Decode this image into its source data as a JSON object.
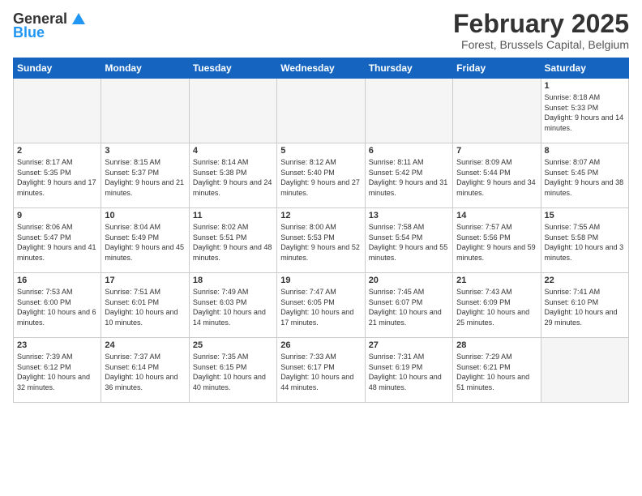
{
  "logo": {
    "general": "General",
    "blue": "Blue"
  },
  "title": "February 2025",
  "location": "Forest, Brussels Capital, Belgium",
  "days_of_week": [
    "Sunday",
    "Monday",
    "Tuesday",
    "Wednesday",
    "Thursday",
    "Friday",
    "Saturday"
  ],
  "weeks": [
    [
      {
        "day": "",
        "info": ""
      },
      {
        "day": "",
        "info": ""
      },
      {
        "day": "",
        "info": ""
      },
      {
        "day": "",
        "info": ""
      },
      {
        "day": "",
        "info": ""
      },
      {
        "day": "",
        "info": ""
      },
      {
        "day": "1",
        "info": "Sunrise: 8:18 AM\nSunset: 5:33 PM\nDaylight: 9 hours and 14 minutes."
      }
    ],
    [
      {
        "day": "2",
        "info": "Sunrise: 8:17 AM\nSunset: 5:35 PM\nDaylight: 9 hours and 17 minutes."
      },
      {
        "day": "3",
        "info": "Sunrise: 8:15 AM\nSunset: 5:37 PM\nDaylight: 9 hours and 21 minutes."
      },
      {
        "day": "4",
        "info": "Sunrise: 8:14 AM\nSunset: 5:38 PM\nDaylight: 9 hours and 24 minutes."
      },
      {
        "day": "5",
        "info": "Sunrise: 8:12 AM\nSunset: 5:40 PM\nDaylight: 9 hours and 27 minutes."
      },
      {
        "day": "6",
        "info": "Sunrise: 8:11 AM\nSunset: 5:42 PM\nDaylight: 9 hours and 31 minutes."
      },
      {
        "day": "7",
        "info": "Sunrise: 8:09 AM\nSunset: 5:44 PM\nDaylight: 9 hours and 34 minutes."
      },
      {
        "day": "8",
        "info": "Sunrise: 8:07 AM\nSunset: 5:45 PM\nDaylight: 9 hours and 38 minutes."
      }
    ],
    [
      {
        "day": "9",
        "info": "Sunrise: 8:06 AM\nSunset: 5:47 PM\nDaylight: 9 hours and 41 minutes."
      },
      {
        "day": "10",
        "info": "Sunrise: 8:04 AM\nSunset: 5:49 PM\nDaylight: 9 hours and 45 minutes."
      },
      {
        "day": "11",
        "info": "Sunrise: 8:02 AM\nSunset: 5:51 PM\nDaylight: 9 hours and 48 minutes."
      },
      {
        "day": "12",
        "info": "Sunrise: 8:00 AM\nSunset: 5:53 PM\nDaylight: 9 hours and 52 minutes."
      },
      {
        "day": "13",
        "info": "Sunrise: 7:58 AM\nSunset: 5:54 PM\nDaylight: 9 hours and 55 minutes."
      },
      {
        "day": "14",
        "info": "Sunrise: 7:57 AM\nSunset: 5:56 PM\nDaylight: 9 hours and 59 minutes."
      },
      {
        "day": "15",
        "info": "Sunrise: 7:55 AM\nSunset: 5:58 PM\nDaylight: 10 hours and 3 minutes."
      }
    ],
    [
      {
        "day": "16",
        "info": "Sunrise: 7:53 AM\nSunset: 6:00 PM\nDaylight: 10 hours and 6 minutes."
      },
      {
        "day": "17",
        "info": "Sunrise: 7:51 AM\nSunset: 6:01 PM\nDaylight: 10 hours and 10 minutes."
      },
      {
        "day": "18",
        "info": "Sunrise: 7:49 AM\nSunset: 6:03 PM\nDaylight: 10 hours and 14 minutes."
      },
      {
        "day": "19",
        "info": "Sunrise: 7:47 AM\nSunset: 6:05 PM\nDaylight: 10 hours and 17 minutes."
      },
      {
        "day": "20",
        "info": "Sunrise: 7:45 AM\nSunset: 6:07 PM\nDaylight: 10 hours and 21 minutes."
      },
      {
        "day": "21",
        "info": "Sunrise: 7:43 AM\nSunset: 6:09 PM\nDaylight: 10 hours and 25 minutes."
      },
      {
        "day": "22",
        "info": "Sunrise: 7:41 AM\nSunset: 6:10 PM\nDaylight: 10 hours and 29 minutes."
      }
    ],
    [
      {
        "day": "23",
        "info": "Sunrise: 7:39 AM\nSunset: 6:12 PM\nDaylight: 10 hours and 32 minutes."
      },
      {
        "day": "24",
        "info": "Sunrise: 7:37 AM\nSunset: 6:14 PM\nDaylight: 10 hours and 36 minutes."
      },
      {
        "day": "25",
        "info": "Sunrise: 7:35 AM\nSunset: 6:15 PM\nDaylight: 10 hours and 40 minutes."
      },
      {
        "day": "26",
        "info": "Sunrise: 7:33 AM\nSunset: 6:17 PM\nDaylight: 10 hours and 44 minutes."
      },
      {
        "day": "27",
        "info": "Sunrise: 7:31 AM\nSunset: 6:19 PM\nDaylight: 10 hours and 48 minutes."
      },
      {
        "day": "28",
        "info": "Sunrise: 7:29 AM\nSunset: 6:21 PM\nDaylight: 10 hours and 51 minutes."
      },
      {
        "day": "",
        "info": ""
      }
    ]
  ]
}
